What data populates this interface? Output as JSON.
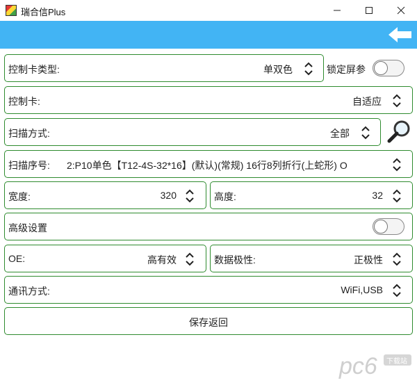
{
  "window": {
    "title": "瑞合信Plus"
  },
  "screen_settings": {
    "controller_type": {
      "label": "控制卡类型:",
      "value": "单双色"
    },
    "lock_screen_params": {
      "label": "锁定屏参",
      "on": false
    },
    "controller": {
      "label": "控制卡:",
      "value": "自适应"
    },
    "scan_mode": {
      "label": "扫描方式:",
      "value": "全部"
    },
    "scan_index": {
      "label": "扫描序号:",
      "value": "2:P10单色【T12-4S-32*16】(默认)(常规) 16行8列折行(上蛇形) O"
    },
    "width": {
      "label": "宽度:",
      "value": "320"
    },
    "height": {
      "label": "高度:",
      "value": "32"
    },
    "advanced": {
      "label": "高级设置",
      "on": false
    },
    "oe": {
      "label": "OE:",
      "value": "高有效"
    },
    "data_polarity": {
      "label": "数据极性:",
      "value": "正极性"
    },
    "comm_mode": {
      "label": "通讯方式:",
      "value": "WiFi,USB"
    },
    "save_button": "保存返回"
  },
  "watermark": {
    "brand": "pc6",
    "sub": "下载站"
  },
  "colors": {
    "accent_blue": "#42b4f4",
    "border_green": "#2e8b2e"
  },
  "icons": [
    "app-icon",
    "minimize-icon",
    "maximize-icon",
    "close-icon",
    "back-arrow-icon",
    "updown-arrow-icon",
    "search-icon"
  ]
}
